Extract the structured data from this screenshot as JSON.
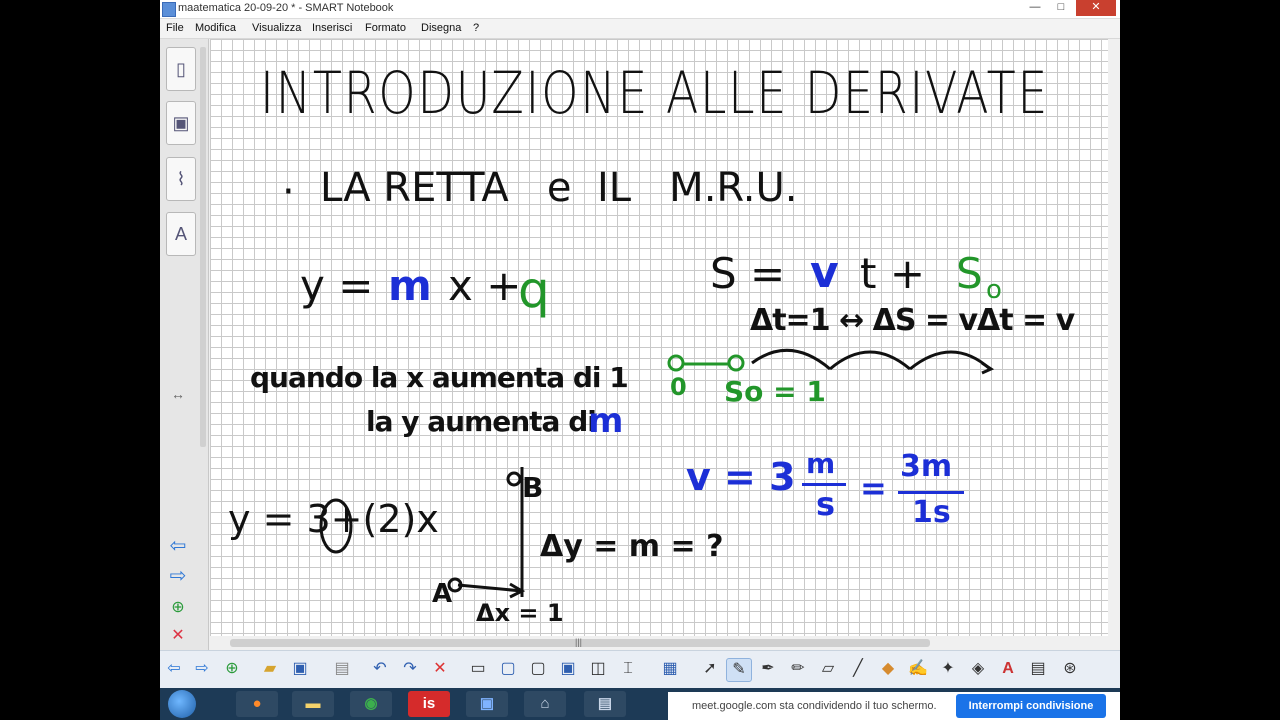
{
  "window": {
    "title": "maatematica 20-09-20 * - SMART Notebook",
    "controls": [
      "—",
      "□",
      "✕"
    ]
  },
  "menu": [
    "File",
    "Modifica",
    "Visualizza",
    "Inserisci",
    "Formato",
    "Disegna",
    "?"
  ],
  "board": {
    "title": "INTRODUZIONE ALLE DERIVATE",
    "bullet": "LA RETTA   e  IL   M.R.U.",
    "line_eq": {
      "y": "y =",
      "m": "m",
      "x": "x +",
      "q": "q"
    },
    "sentence1": "quando la x aumenta di 1",
    "sentence2": "la y aumenta di",
    "sentence2_m": "m",
    "eq2": "y = 3+(2)x",
    "graph": {
      "b": "B",
      "a": "A",
      "dy": "Δy = m = ?",
      "dx": "Δx = 1"
    },
    "motion": {
      "s": "S =",
      "v": "v",
      "t": "t +",
      "s0": "S",
      "s0_sub": "o",
      "dt": "Δt=1 ↔ ΔS = vΔt = v",
      "zero": "0",
      "s0_label": "So = 1"
    },
    "velocity": {
      "v": "v = 3",
      "m_num": "m",
      "m_den": "s",
      "eq": "=",
      "frac_num": "3m",
      "frac_den": "1s"
    },
    "colors": {
      "ink": "#111111",
      "blue": "#1c2fd6",
      "green": "#22962a"
    }
  },
  "share": {
    "message": "meet.google.com sta condividendo il tuo schermo.",
    "stop": "Interrompi condivisione"
  },
  "taskbar": {
    "app_is": "is"
  }
}
